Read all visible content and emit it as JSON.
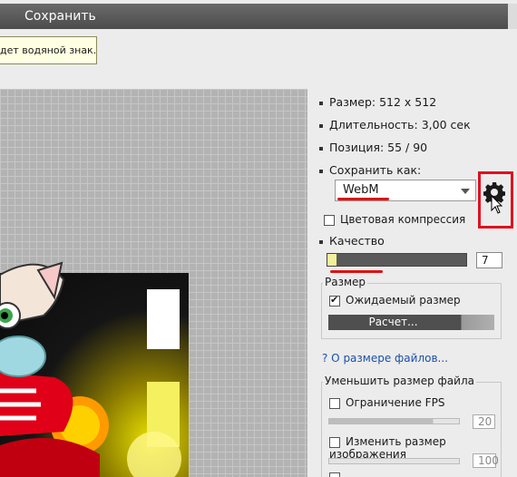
{
  "window": {
    "title": "Сохранить"
  },
  "tooltip": {
    "text": "дет водяной знак."
  },
  "info": {
    "size": "Размер: 512 x 512",
    "duration": "Длительность: 3,00 сек",
    "position": "Позиция: 55 / 90",
    "save_as_label": "Сохранить как:"
  },
  "format": {
    "selected": "WebM"
  },
  "color_compression": {
    "label": "Цветовая компрессия",
    "checked": false
  },
  "quality": {
    "label": "Качество",
    "value": "7"
  },
  "size_group": {
    "label": "Размер",
    "expected_size_label": "Ожидаемый размер",
    "expected_size_checked": true,
    "calc_button": "Расчет..."
  },
  "help_link": "? О размере файлов...",
  "reduce_group": {
    "label": "Уменьшить размер файла",
    "fps_limit_label": "Ограничение FPS",
    "fps_value": "20",
    "resize_label": "Изменить размер изображения",
    "resize_value": "100"
  },
  "icons": {
    "settings": "gear-icon",
    "cursor": "mouse-pointer-icon"
  },
  "colors": {
    "highlight_red": "#e01020",
    "titlebar": "#555555",
    "link": "#1a4fa8"
  }
}
